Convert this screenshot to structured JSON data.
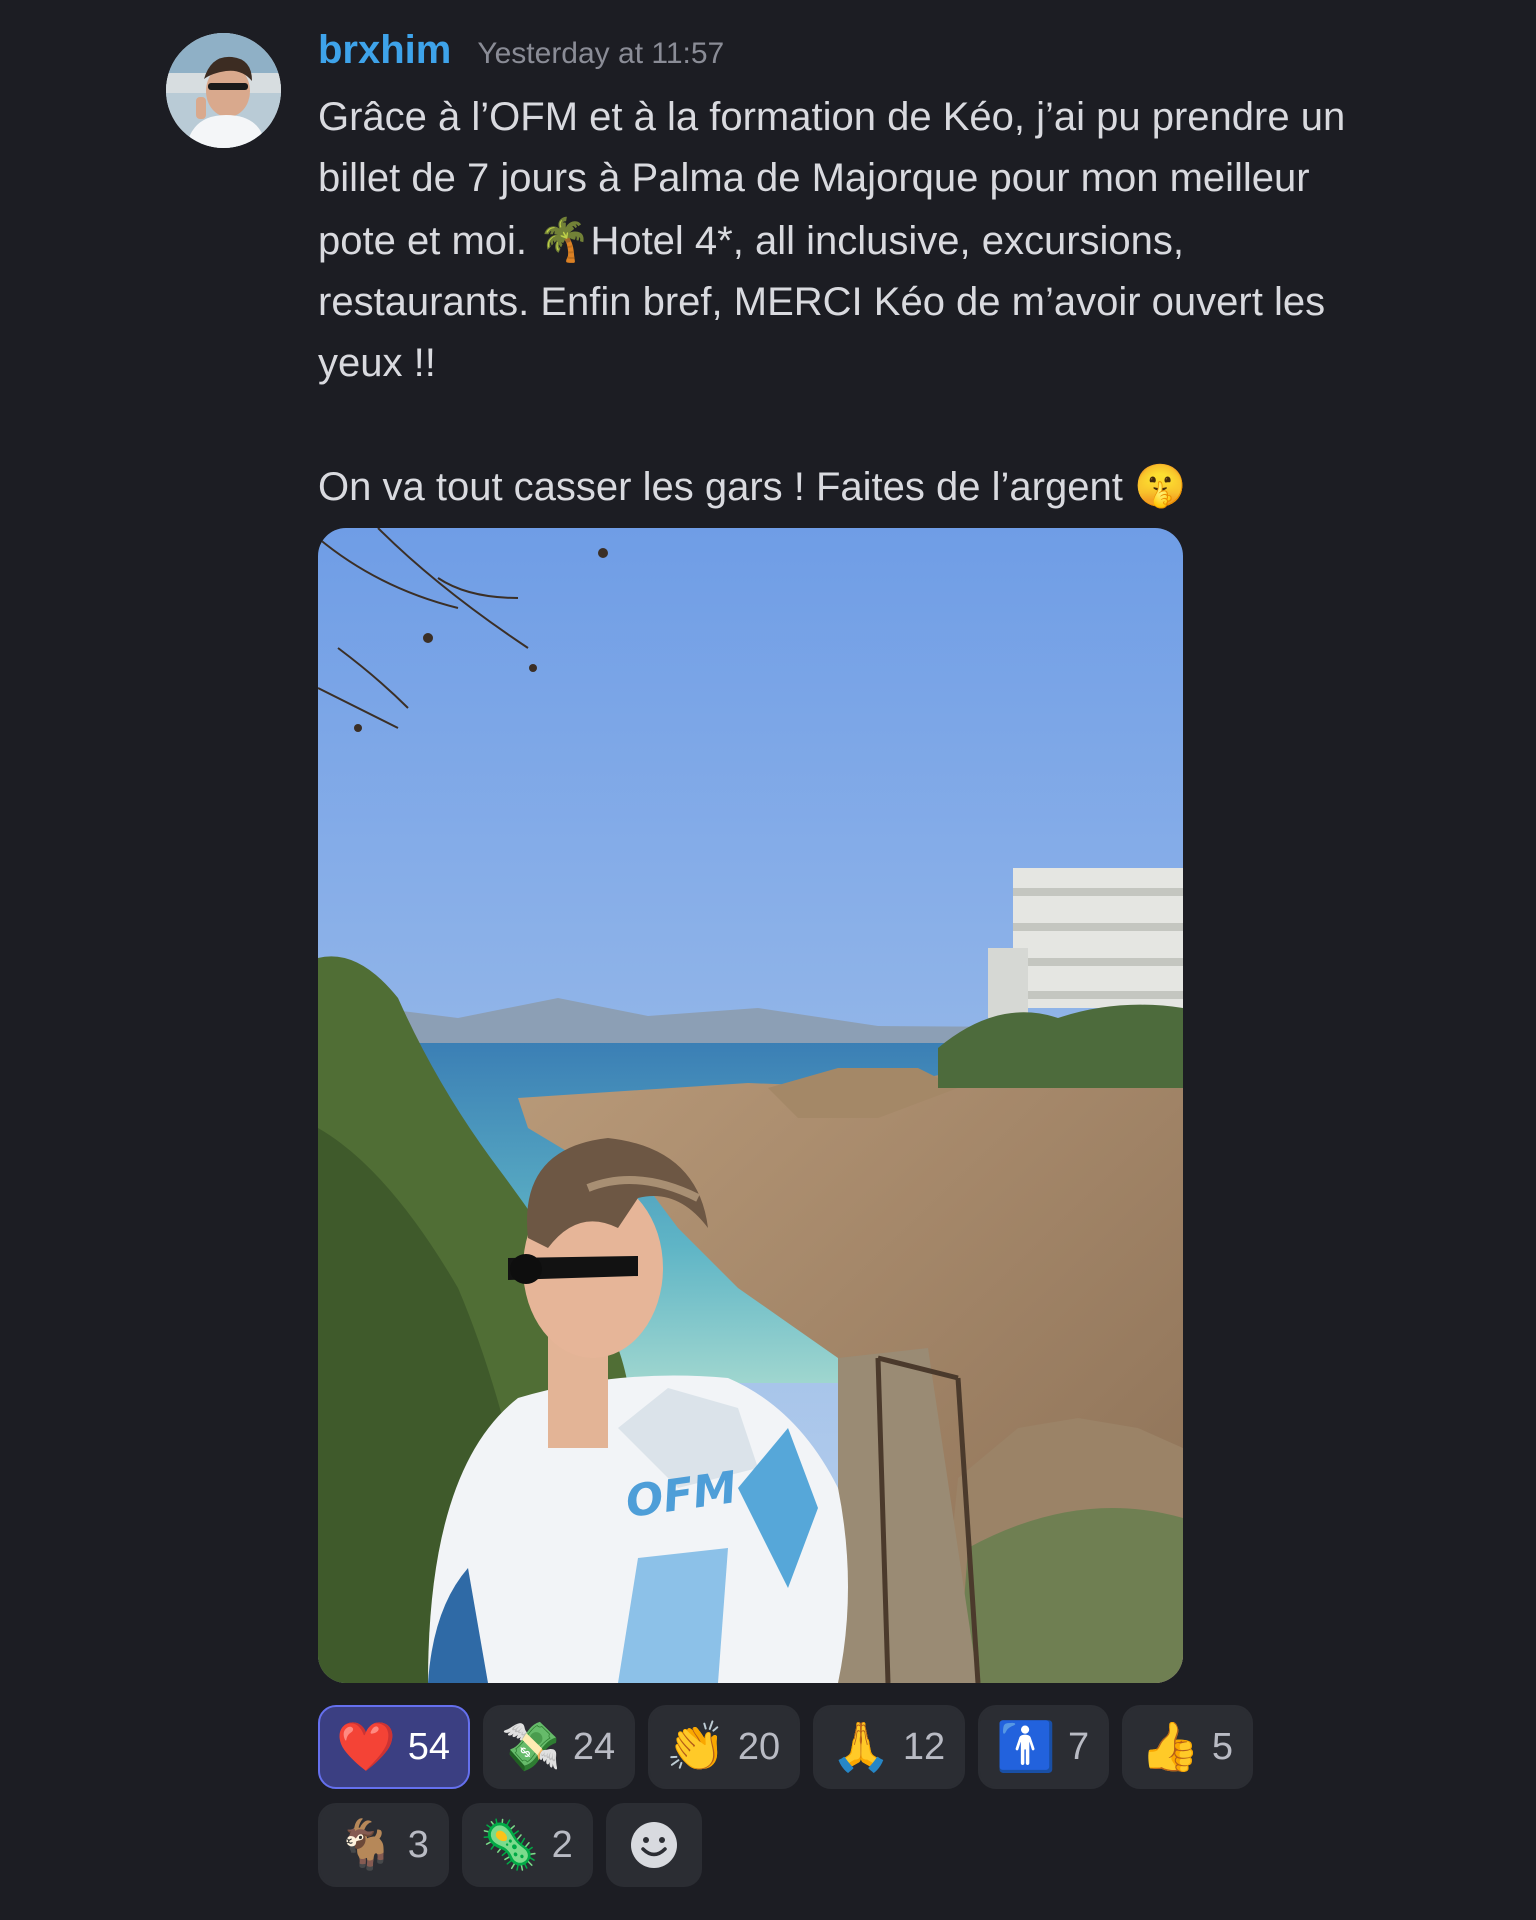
{
  "author": {
    "username": "brxhim",
    "timestamp": "Yesterday at 11:57"
  },
  "message": {
    "paragraphs": [
      "Grâce à l’OFM et à la formation de Kéo, j’ai pu prendre un billet de 7 jours à Palma de Majorque pour mon meilleur pote et moi.",
      "Hotel 4*, all inclusive, excursions, restaurants. Enfin bref, MERCI Kéo de m’avoir ouvert les yeux !!",
      "On va tout casser les gars ! Faites de l’argent"
    ],
    "emoji_palm": "🌴",
    "emoji_shush": "🤫",
    "image_shirt_text": "OFM"
  },
  "reactions": [
    {
      "emoji": "❤️",
      "count": "54",
      "me": true
    },
    {
      "emoji": "💸",
      "count": "24",
      "me": false
    },
    {
      "emoji": "👏",
      "count": "20",
      "me": false
    },
    {
      "emoji": "🙏",
      "count": "12",
      "me": false
    },
    {
      "emoji": "🚹",
      "count": "7",
      "me": false
    },
    {
      "emoji": "👍",
      "count": "5",
      "me": false
    },
    {
      "emoji": "🐐",
      "count": "3",
      "me": false
    },
    {
      "emoji": "🦠",
      "count": "2",
      "me": false
    }
  ],
  "colors": {
    "background": "#1c1d23",
    "username": "#3ea3ea",
    "reaction_selected_bg": "#3b3f82",
    "reaction_selected_border": "#6570ee"
  }
}
